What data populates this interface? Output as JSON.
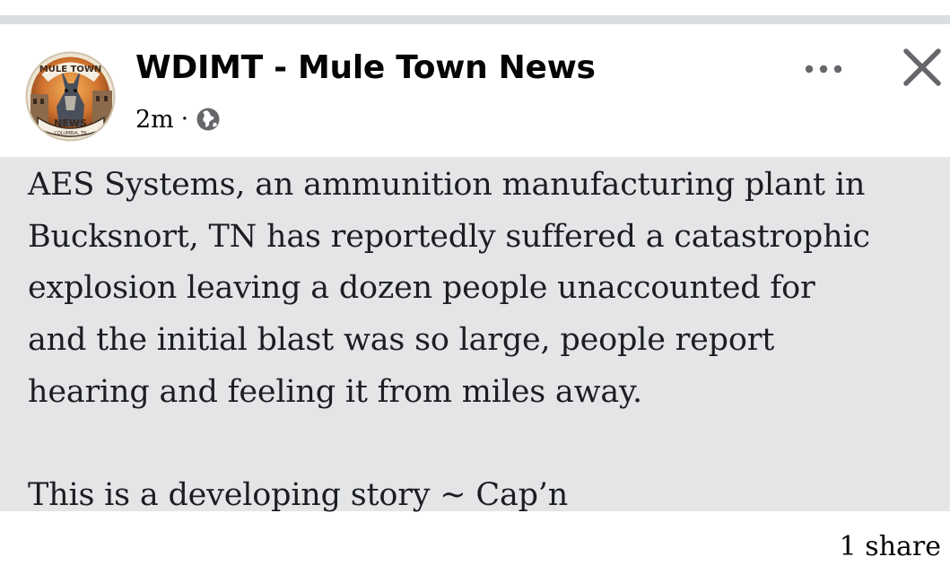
{
  "post": {
    "page_name": "WDIMT - Mule Town News",
    "timestamp": "2m",
    "separator": "·",
    "audience_icon": "globe-icon",
    "paragraphs": [
      "AES Systems, an ammunition manufacturing plant in\nBucksnort, TN has reportedly suffered a catastrophic\nexplosion leaving a dozen people unaccounted for\nand the initial blast was so large, people report\nhearing and feeling it from miles away.\n\nThis is a developing story ~ Cap’n"
    ],
    "share_count": "1 share",
    "avatar_logo_text": [
      "MURIA NE",
      "MULE TOWN",
      "NEWS",
      "COLUMBIA, TN"
    ]
  },
  "colors": {
    "text_background": "#e4e5e6",
    "divider": "#dadde1",
    "icon_gray": "#65676b"
  }
}
